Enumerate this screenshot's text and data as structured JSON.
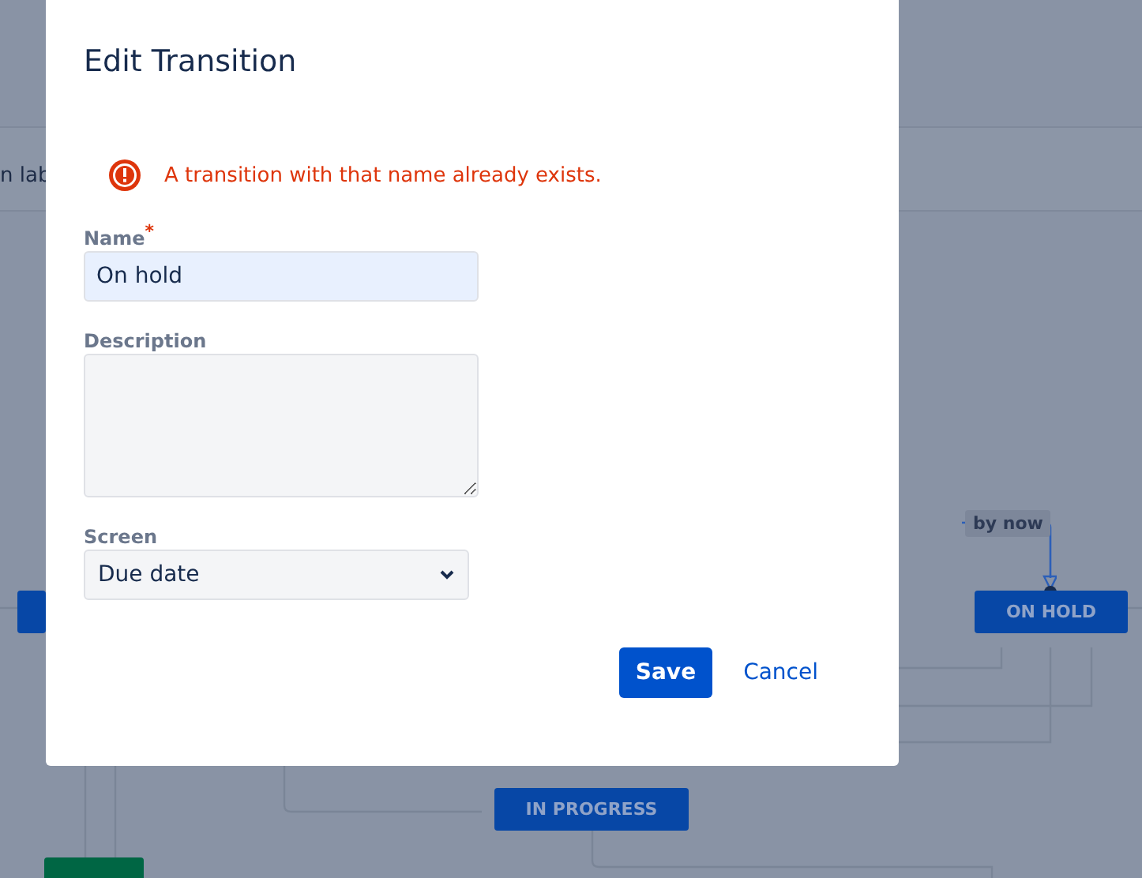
{
  "background": {
    "header_text": "n lab",
    "transition_label": "by now",
    "statuses": [
      {
        "label": "ON HOLD",
        "color": "#0747a6"
      },
      {
        "label": "IN PROGRESS",
        "color": "#0747a6"
      },
      {
        "color": "#006644"
      }
    ]
  },
  "dialog": {
    "title": "Edit Transition",
    "error": "A transition with that name already exists.",
    "fields": [
      {
        "kind": "text",
        "label": "Name",
        "required_mark": "*",
        "value": "On hold"
      },
      {
        "kind": "textarea",
        "label": "Description"
      },
      {
        "kind": "select",
        "label": "Screen",
        "value": "Due date"
      }
    ],
    "buttons": [
      {
        "kind": "primary",
        "label": "Save"
      },
      {
        "kind": "link",
        "label": "Cancel"
      }
    ]
  }
}
